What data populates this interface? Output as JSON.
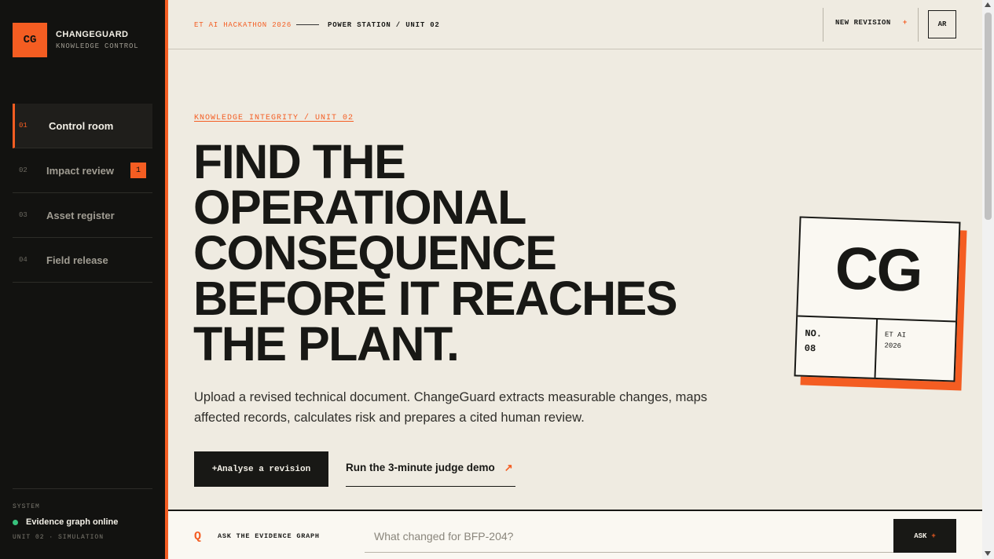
{
  "brand": {
    "logo": "CG",
    "name": "CHANGEGUARD",
    "subtitle": "KNOWLEDGE CONTROL"
  },
  "nav": [
    {
      "num": "01",
      "label": "Control room",
      "active": true
    },
    {
      "num": "02",
      "label": "Impact review",
      "badge": "1"
    },
    {
      "num": "03",
      "label": "Asset register"
    },
    {
      "num": "04",
      "label": "Field release"
    }
  ],
  "system": {
    "label": "SYSTEM",
    "status": "Evidence graph online",
    "status_color": "#37c27d",
    "unit": "UNIT 02 · SIMULATION"
  },
  "topbar": {
    "event": "ET AI HACKATHON 2026",
    "location": "POWER STATION / UNIT 02",
    "new_revision": "NEW REVISION",
    "new_revision_icon": "+",
    "avatar": "AR"
  },
  "hero": {
    "eyebrow": "KNOWLEDGE INTEGRITY / UNIT 02",
    "headline_lines": [
      "FIND THE",
      "OPERATIONAL",
      "CONSEQUENCE",
      "BEFORE IT REACHES",
      "THE PLANT."
    ],
    "lede": "Upload a revised technical document. ChangeGuard extracts measurable changes, maps affected records, calculates risk and prepares a cited human review.",
    "primary_button": "+Analyse a revision",
    "link_button": "Run the 3-minute judge demo",
    "link_icon": "↗"
  },
  "card": {
    "monogram": "CG",
    "no_label": "NO.",
    "no_value": "08",
    "event_line1": "ET AI",
    "event_line2": "2026"
  },
  "ask": {
    "icon": "Q",
    "label": "ASK THE EVIDENCE GRAPH",
    "placeholder": "What changed for BFP-204?",
    "button": "ASK",
    "button_icon": "+"
  },
  "colors": {
    "accent": "#f45d22",
    "ink": "#181815",
    "paper": "#efebe1",
    "sidebar": "#121210"
  }
}
